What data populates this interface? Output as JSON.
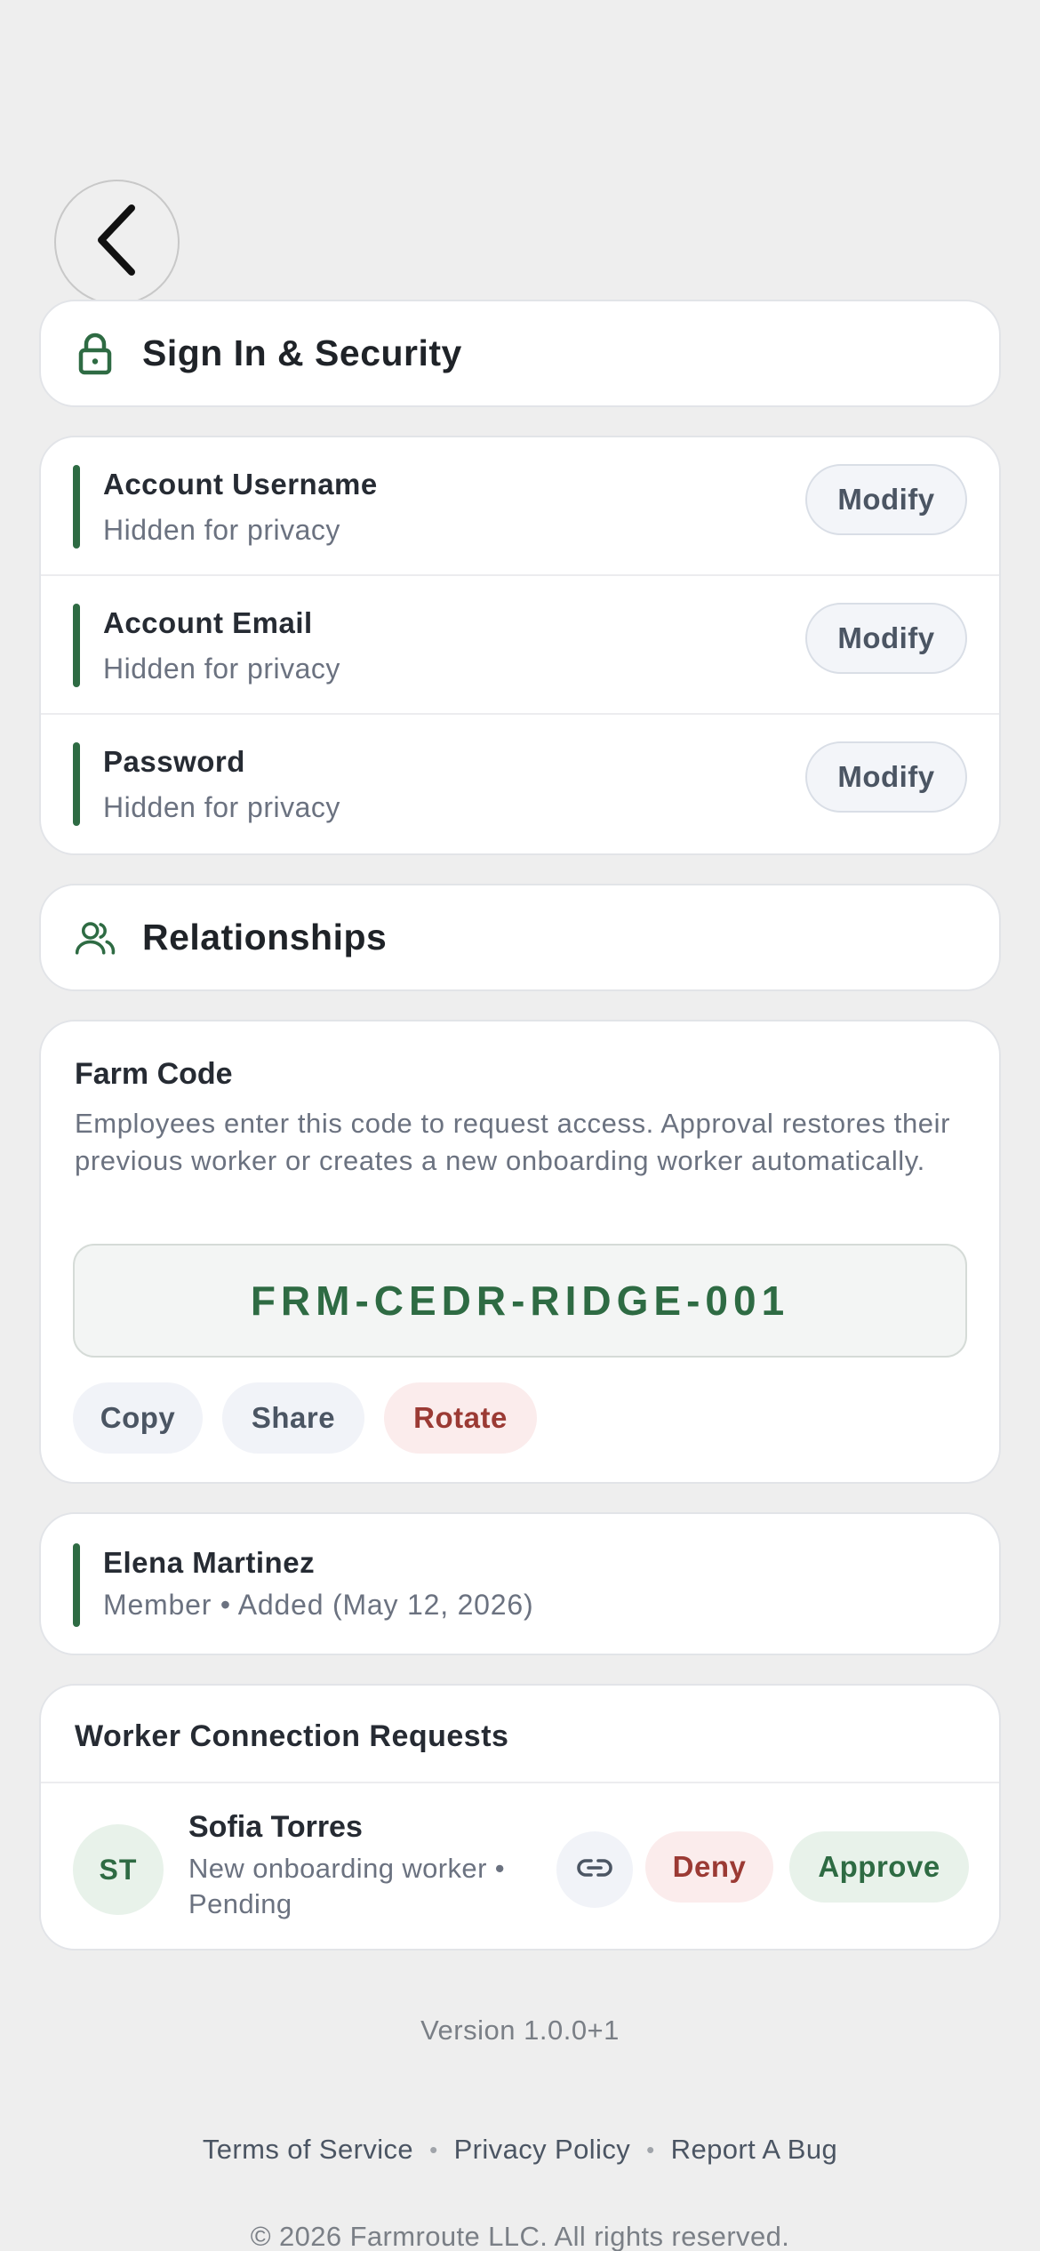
{
  "security": {
    "title": "Sign In & Security",
    "rows": [
      {
        "title": "Account Username",
        "subtitle": "Hidden for privacy",
        "action": "Modify"
      },
      {
        "title": "Account Email",
        "subtitle": "Hidden for privacy",
        "action": "Modify"
      },
      {
        "title": "Password",
        "subtitle": "Hidden for privacy",
        "action": "Modify"
      }
    ]
  },
  "relationships": {
    "title": "Relationships"
  },
  "farm_code": {
    "title": "Farm Code",
    "description": "Employees enter this code to request access. Approval restores their previous worker or creates a new onboarding worker automatically.",
    "code": "FRM-CEDR-RIDGE-001",
    "copy_label": "Copy",
    "share_label": "Share",
    "rotate_label": "Rotate"
  },
  "member": {
    "name": "Elena Martinez",
    "subtitle": "Member • Added (May 12, 2026)"
  },
  "requests": {
    "title": "Worker Connection Requests",
    "items": [
      {
        "initials": "ST",
        "name": "Sofia Torres",
        "subtitle": "New onboarding worker • Pending",
        "deny_label": "Deny",
        "approve_label": "Approve"
      }
    ]
  },
  "footer": {
    "version": "Version 1.0.0+1",
    "links": [
      "Terms of Service",
      "Privacy Policy",
      "Report A Bug"
    ],
    "copyright": "© 2026 Farmroute LLC. All rights reserved."
  },
  "colors": {
    "accent_green": "#2e6b43",
    "danger_red": "#9b3a34",
    "background": "#eeeeee"
  },
  "icons": {
    "back": "chevron-left-icon",
    "security": "lock-icon",
    "relationships": "users-icon",
    "link": "link-icon"
  }
}
